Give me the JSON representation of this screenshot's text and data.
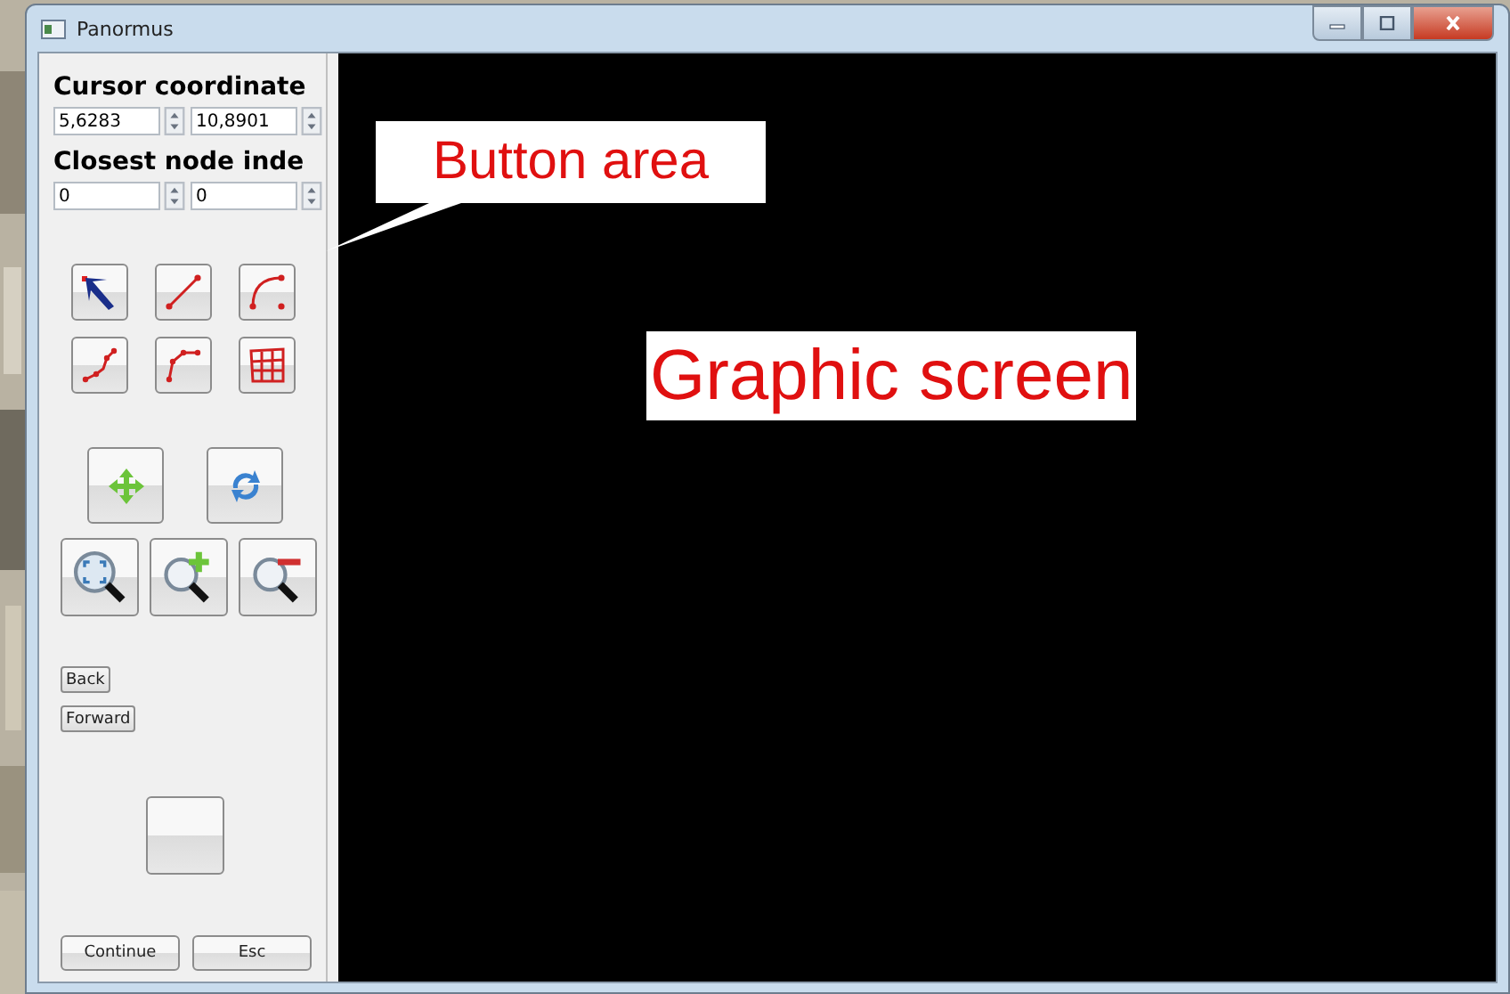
{
  "window": {
    "title": "Panormus"
  },
  "panel": {
    "cursor_heading": "Cursor coordinate",
    "cursor_fields": [
      {
        "value": "5,6283"
      },
      {
        "value": "10,8901"
      }
    ],
    "node_heading": "Closest node inde",
    "node_fields": [
      {
        "value": "0"
      },
      {
        "value": "0"
      }
    ],
    "nav_buttons": [
      "Back",
      "Forward"
    ],
    "footer_buttons": [
      "Continue",
      "Esc"
    ]
  },
  "annotations": [
    {
      "text": "Button area"
    },
    {
      "text": "Graphic screen"
    }
  ]
}
